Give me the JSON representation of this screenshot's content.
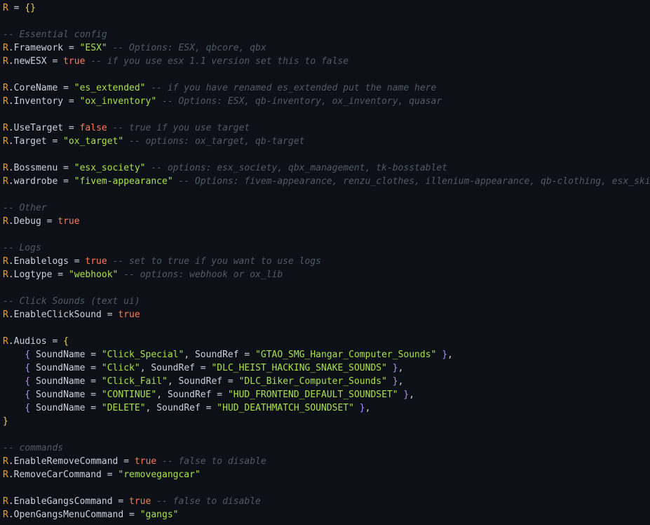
{
  "editor": {
    "language": "lua",
    "colors": {
      "background": "#0d1117",
      "table_R": "#f0a020",
      "brace_outer": "#f3d34a",
      "brace_inner": "#b58bff",
      "identifier": "#c9d1d9",
      "string": "#a8e04a",
      "boolean": "#ff7b56",
      "comment": "#4f5a66"
    },
    "lines": [
      [
        {
          "t": "R",
          "c": "R"
        },
        {
          "t": "op",
          "c": " = "
        },
        {
          "t": "brace",
          "c": "{}"
        }
      ],
      [],
      [
        {
          "t": "comment",
          "c": "-- Essential config"
        }
      ],
      [
        {
          "t": "R",
          "c": "R"
        },
        {
          "t": "ident",
          "c": ".Framework"
        },
        {
          "t": "op",
          "c": " = "
        },
        {
          "t": "str",
          "c": "\"ESX\""
        },
        {
          "t": "comment",
          "c": " -- Options: ESX, qbcore, qbx"
        }
      ],
      [
        {
          "t": "R",
          "c": "R"
        },
        {
          "t": "ident",
          "c": ".newESX"
        },
        {
          "t": "op",
          "c": " = "
        },
        {
          "t": "bool",
          "c": "true"
        },
        {
          "t": "comment",
          "c": " -- if you use esx 1.1 version set this to false"
        }
      ],
      [],
      [
        {
          "t": "R",
          "c": "R"
        },
        {
          "t": "ident",
          "c": ".CoreName"
        },
        {
          "t": "op",
          "c": " = "
        },
        {
          "t": "str",
          "c": "\"es_extended\""
        },
        {
          "t": "comment",
          "c": " -- if you have renamed es_extended put the name here"
        }
      ],
      [
        {
          "t": "R",
          "c": "R"
        },
        {
          "t": "ident",
          "c": ".Inventory"
        },
        {
          "t": "op",
          "c": " = "
        },
        {
          "t": "str",
          "c": "\"ox_inventory\""
        },
        {
          "t": "comment",
          "c": " -- Options: ESX, qb-inventory, ox_inventory, quasar"
        }
      ],
      [],
      [
        {
          "t": "R",
          "c": "R"
        },
        {
          "t": "ident",
          "c": ".UseTarget"
        },
        {
          "t": "op",
          "c": " = "
        },
        {
          "t": "bool",
          "c": "false"
        },
        {
          "t": "comment",
          "c": " -- true if you use target"
        }
      ],
      [
        {
          "t": "R",
          "c": "R"
        },
        {
          "t": "ident",
          "c": ".Target"
        },
        {
          "t": "op",
          "c": " = "
        },
        {
          "t": "str",
          "c": "\"ox_target\""
        },
        {
          "t": "comment",
          "c": " -- options: ox_target, qb-target"
        }
      ],
      [],
      [
        {
          "t": "R",
          "c": "R"
        },
        {
          "t": "ident",
          "c": ".Bossmenu"
        },
        {
          "t": "op",
          "c": " = "
        },
        {
          "t": "str",
          "c": "\"esx_society\""
        },
        {
          "t": "comment",
          "c": " -- options: esx_society, qbx_management, tk-bosstablet"
        }
      ],
      [
        {
          "t": "R",
          "c": "R"
        },
        {
          "t": "ident",
          "c": ".wardrobe"
        },
        {
          "t": "op",
          "c": " = "
        },
        {
          "t": "str",
          "c": "\"fivem-appearance\""
        },
        {
          "t": "comment",
          "c": " -- Options: fivem-appearance, renzu_clothes, illenium-appearance, qb-clothing, esx_skin"
        }
      ],
      [],
      [
        {
          "t": "comment",
          "c": "-- Other"
        }
      ],
      [
        {
          "t": "R",
          "c": "R"
        },
        {
          "t": "ident",
          "c": ".Debug"
        },
        {
          "t": "op",
          "c": " = "
        },
        {
          "t": "bool",
          "c": "true"
        }
      ],
      [],
      [
        {
          "t": "comment",
          "c": "-- Logs"
        }
      ],
      [
        {
          "t": "R",
          "c": "R"
        },
        {
          "t": "ident",
          "c": ".Enablelogs"
        },
        {
          "t": "op",
          "c": " = "
        },
        {
          "t": "bool",
          "c": "true"
        },
        {
          "t": "comment",
          "c": " -- set to true if you want to use logs"
        }
      ],
      [
        {
          "t": "R",
          "c": "R"
        },
        {
          "t": "ident",
          "c": ".Logtype"
        },
        {
          "t": "op",
          "c": " = "
        },
        {
          "t": "str",
          "c": "\"webhook\""
        },
        {
          "t": "comment",
          "c": " -- options: webhook or ox_lib"
        }
      ],
      [],
      [
        {
          "t": "comment",
          "c": "-- Click Sounds (text ui)"
        }
      ],
      [
        {
          "t": "R",
          "c": "R"
        },
        {
          "t": "ident",
          "c": ".EnableClickSound"
        },
        {
          "t": "op",
          "c": " = "
        },
        {
          "t": "bool",
          "c": "true"
        }
      ],
      [],
      [
        {
          "t": "R",
          "c": "R"
        },
        {
          "t": "ident",
          "c": ".Audios"
        },
        {
          "t": "op",
          "c": " = "
        },
        {
          "t": "brace",
          "c": "{"
        }
      ],
      [
        {
          "t": "indent",
          "c": "    "
        },
        {
          "t": "inbrace",
          "c": "{"
        },
        {
          "t": "ident",
          "c": " SoundName"
        },
        {
          "t": "op",
          "c": " = "
        },
        {
          "t": "str",
          "c": "\"Click_Special\""
        },
        {
          "t": "punct",
          "c": ", "
        },
        {
          "t": "ident",
          "c": "SoundRef"
        },
        {
          "t": "op",
          "c": " = "
        },
        {
          "t": "str",
          "c": "\"GTAO_SMG_Hangar_Computer_Sounds\""
        },
        {
          "t": "punct",
          "c": " "
        },
        {
          "t": "inbrace",
          "c": "}"
        },
        {
          "t": "punct",
          "c": ","
        }
      ],
      [
        {
          "t": "indent",
          "c": "    "
        },
        {
          "t": "inbrace",
          "c": "{"
        },
        {
          "t": "ident",
          "c": " SoundName"
        },
        {
          "t": "op",
          "c": " = "
        },
        {
          "t": "str",
          "c": "\"Click\""
        },
        {
          "t": "punct",
          "c": ", "
        },
        {
          "t": "ident",
          "c": "SoundRef"
        },
        {
          "t": "op",
          "c": " = "
        },
        {
          "t": "str",
          "c": "\"DLC_HEIST_HACKING_SNAKE_SOUNDS\""
        },
        {
          "t": "punct",
          "c": " "
        },
        {
          "t": "inbrace",
          "c": "}"
        },
        {
          "t": "punct",
          "c": ","
        }
      ],
      [
        {
          "t": "indent",
          "c": "    "
        },
        {
          "t": "inbrace",
          "c": "{"
        },
        {
          "t": "ident",
          "c": " SoundName"
        },
        {
          "t": "op",
          "c": " = "
        },
        {
          "t": "str",
          "c": "\"Click_Fail\""
        },
        {
          "t": "punct",
          "c": ", "
        },
        {
          "t": "ident",
          "c": "SoundRef"
        },
        {
          "t": "op",
          "c": " = "
        },
        {
          "t": "str",
          "c": "\"DLC_Biker_Computer_Sounds\""
        },
        {
          "t": "punct",
          "c": " "
        },
        {
          "t": "inbrace",
          "c": "}"
        },
        {
          "t": "punct",
          "c": ","
        }
      ],
      [
        {
          "t": "indent",
          "c": "    "
        },
        {
          "t": "inbrace",
          "c": "{"
        },
        {
          "t": "ident",
          "c": " SoundName"
        },
        {
          "t": "op",
          "c": " = "
        },
        {
          "t": "str",
          "c": "\"CONTINUE\""
        },
        {
          "t": "punct",
          "c": ", "
        },
        {
          "t": "ident",
          "c": "SoundRef"
        },
        {
          "t": "op",
          "c": " = "
        },
        {
          "t": "str",
          "c": "\"HUD_FRONTEND_DEFAULT_SOUNDSET\""
        },
        {
          "t": "punct",
          "c": " "
        },
        {
          "t": "inbrace",
          "c": "}"
        },
        {
          "t": "punct",
          "c": ","
        }
      ],
      [
        {
          "t": "indent",
          "c": "    "
        },
        {
          "t": "inbrace",
          "c": "{"
        },
        {
          "t": "ident",
          "c": " SoundName"
        },
        {
          "t": "op",
          "c": " = "
        },
        {
          "t": "str",
          "c": "\"DELETE\""
        },
        {
          "t": "punct",
          "c": ", "
        },
        {
          "t": "ident",
          "c": "SoundRef"
        },
        {
          "t": "op",
          "c": " = "
        },
        {
          "t": "str",
          "c": "\"HUD_DEATHMATCH_SOUNDSET\""
        },
        {
          "t": "punct",
          "c": " "
        },
        {
          "t": "inbrace",
          "c": "}"
        },
        {
          "t": "punct",
          "c": ","
        }
      ],
      [
        {
          "t": "brace",
          "c": "}"
        }
      ],
      [],
      [
        {
          "t": "comment",
          "c": "-- commands"
        }
      ],
      [
        {
          "t": "R",
          "c": "R"
        },
        {
          "t": "ident",
          "c": ".EnableRemoveCommand"
        },
        {
          "t": "op",
          "c": " = "
        },
        {
          "t": "bool",
          "c": "true"
        },
        {
          "t": "comment",
          "c": " -- false to disable"
        }
      ],
      [
        {
          "t": "R",
          "c": "R"
        },
        {
          "t": "ident",
          "c": ".RemoveCarCommand"
        },
        {
          "t": "op",
          "c": " = "
        },
        {
          "t": "str",
          "c": "\"removegangcar\""
        }
      ],
      [],
      [
        {
          "t": "R",
          "c": "R"
        },
        {
          "t": "ident",
          "c": ".EnableGangsCommand"
        },
        {
          "t": "op",
          "c": " = "
        },
        {
          "t": "bool",
          "c": "true"
        },
        {
          "t": "comment",
          "c": " -- false to disable"
        }
      ],
      [
        {
          "t": "R",
          "c": "R"
        },
        {
          "t": "ident",
          "c": ".OpenGangsMenuCommand"
        },
        {
          "t": "op",
          "c": " = "
        },
        {
          "t": "str",
          "c": "\"gangs\""
        }
      ]
    ]
  }
}
